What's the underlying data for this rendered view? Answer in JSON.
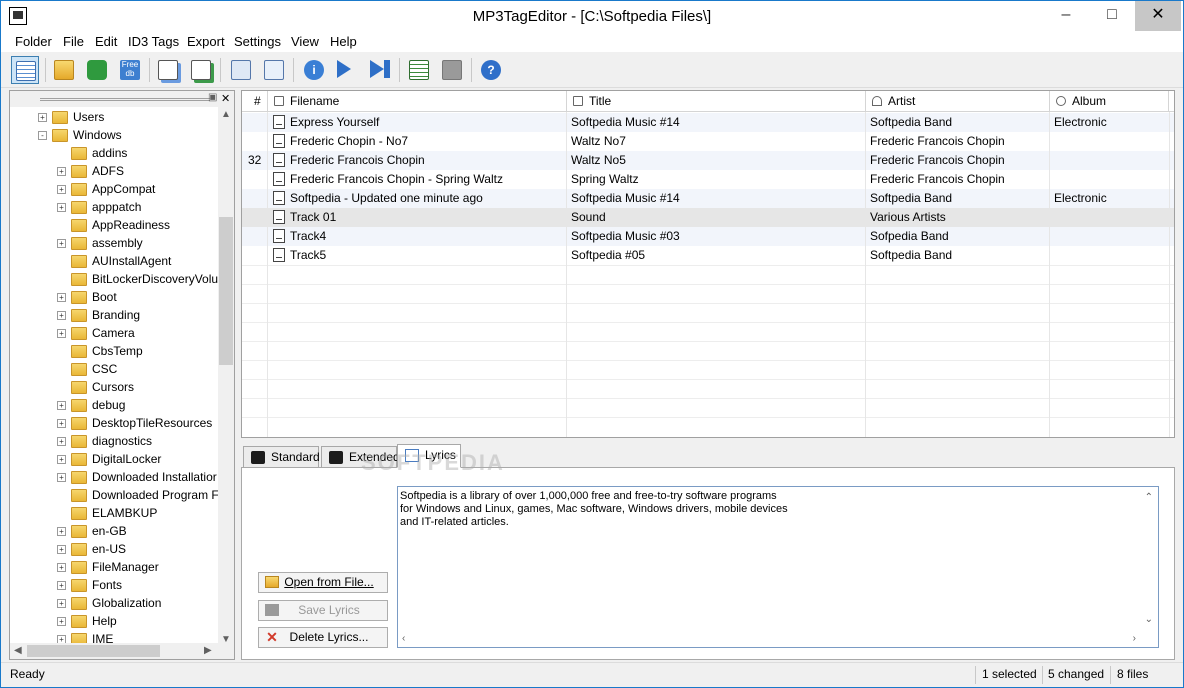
{
  "window": {
    "title": "MP3TagEditor - [C:\\Softpedia Files\\]"
  },
  "menu": [
    "Folder",
    "File",
    "Edit",
    "ID3 Tags",
    "Export",
    "Settings",
    "View",
    "Help"
  ],
  "toolbar_icons": [
    "list-view-icon",
    "open-folder-icon",
    "refresh-icon",
    "freedb-icon",
    "copy-tags-icon",
    "move-tags-icon",
    "tag-edit-icon",
    "download-icon",
    "info-icon",
    "play-icon",
    "play-all-icon",
    "details-view-icon",
    "blank-icon",
    "help-icon"
  ],
  "toolbar_freedb": {
    "line1": "Free",
    "line2": "db"
  },
  "tree": {
    "items": [
      {
        "label": "Users",
        "level": 1,
        "expander": "+"
      },
      {
        "label": "Windows",
        "level": 1,
        "expander": "-"
      },
      {
        "label": "addins",
        "level": 2,
        "expander": ""
      },
      {
        "label": "ADFS",
        "level": 2,
        "expander": "+"
      },
      {
        "label": "AppCompat",
        "level": 2,
        "expander": "+"
      },
      {
        "label": "apppatch",
        "level": 2,
        "expander": "+"
      },
      {
        "label": "AppReadiness",
        "level": 2,
        "expander": ""
      },
      {
        "label": "assembly",
        "level": 2,
        "expander": "+"
      },
      {
        "label": "AUInstallAgent",
        "level": 2,
        "expander": ""
      },
      {
        "label": "BitLockerDiscoveryVolu",
        "level": 2,
        "expander": ""
      },
      {
        "label": "Boot",
        "level": 2,
        "expander": "+"
      },
      {
        "label": "Branding",
        "level": 2,
        "expander": "+"
      },
      {
        "label": "Camera",
        "level": 2,
        "expander": "+"
      },
      {
        "label": "CbsTemp",
        "level": 2,
        "expander": ""
      },
      {
        "label": "CSC",
        "level": 2,
        "expander": ""
      },
      {
        "label": "Cursors",
        "level": 2,
        "expander": ""
      },
      {
        "label": "debug",
        "level": 2,
        "expander": "+"
      },
      {
        "label": "DesktopTileResources",
        "level": 2,
        "expander": "+"
      },
      {
        "label": "diagnostics",
        "level": 2,
        "expander": "+"
      },
      {
        "label": "DigitalLocker",
        "level": 2,
        "expander": "+"
      },
      {
        "label": "Downloaded Installatior",
        "level": 2,
        "expander": "+"
      },
      {
        "label": "Downloaded Program F",
        "level": 2,
        "expander": ""
      },
      {
        "label": "ELAMBKUP",
        "level": 2,
        "expander": ""
      },
      {
        "label": "en-GB",
        "level": 2,
        "expander": "+"
      },
      {
        "label": "en-US",
        "level": 2,
        "expander": "+"
      },
      {
        "label": "FileManager",
        "level": 2,
        "expander": "+"
      },
      {
        "label": "Fonts",
        "level": 2,
        "expander": "+"
      },
      {
        "label": "Globalization",
        "level": 2,
        "expander": "+"
      },
      {
        "label": "Help",
        "level": 2,
        "expander": "+"
      },
      {
        "label": "IME",
        "level": 2,
        "expander": "+"
      }
    ]
  },
  "list": {
    "columns": [
      "#",
      "Filename",
      "Title",
      "Artist",
      "Album"
    ],
    "rows": [
      {
        "num": "",
        "filename": "Express Yourself",
        "title": "Softpedia Music #14",
        "artist": "Softpedia Band",
        "album": "Electronic"
      },
      {
        "num": "",
        "filename": "Frederic Chopin - No7",
        "title": "Waltz No7",
        "artist": "Frederic Francois Chopin",
        "album": ""
      },
      {
        "num": "32",
        "filename": "Frederic Francois Chopin",
        "title": "Waltz No5",
        "artist": "Frederic Francois Chopin",
        "album": ""
      },
      {
        "num": "",
        "filename": "Frederic Francois Chopin - Spring Waltz",
        "title": "Spring Waltz",
        "artist": "Frederic Francois Chopin",
        "album": ""
      },
      {
        "num": "",
        "filename": "Softpedia - Updated one minute ago",
        "title": "Softpedia Music #14",
        "artist": "Softpedia Band",
        "album": "Electronic"
      },
      {
        "num": "",
        "filename": "Track 01",
        "title": "Sound",
        "artist": "Various Artists",
        "album": ""
      },
      {
        "num": "",
        "filename": "Track4",
        "title": "Softpedia Music #03",
        "artist": "Sofpedia Band",
        "album": ""
      },
      {
        "num": "",
        "filename": "Track5",
        "title": "Softpedia #05",
        "artist": "Softpedia Band",
        "album": ""
      }
    ]
  },
  "tabs": [
    "Standard",
    "Extended",
    "Lyrics"
  ],
  "active_tab": "Lyrics",
  "watermark": "SOFTPEDIA",
  "lyrics": {
    "buttons": {
      "open": "Open from File...",
      "save": "Save Lyrics",
      "delete": "Delete Lyrics..."
    },
    "lines": [
      "Softpedia is a library of over 1,000,000 free and free-to-try software programs",
      "for Windows and Linux, games, Mac software, Windows drivers, mobile devices",
      "and IT-related articles."
    ]
  },
  "status": {
    "left": "Ready",
    "selected": "1 selected",
    "changed": "5 changed",
    "files": "8 files"
  },
  "colors": {
    "accent": "#1979ca",
    "selection": "#cce4f7",
    "folder": "#e9b737"
  }
}
